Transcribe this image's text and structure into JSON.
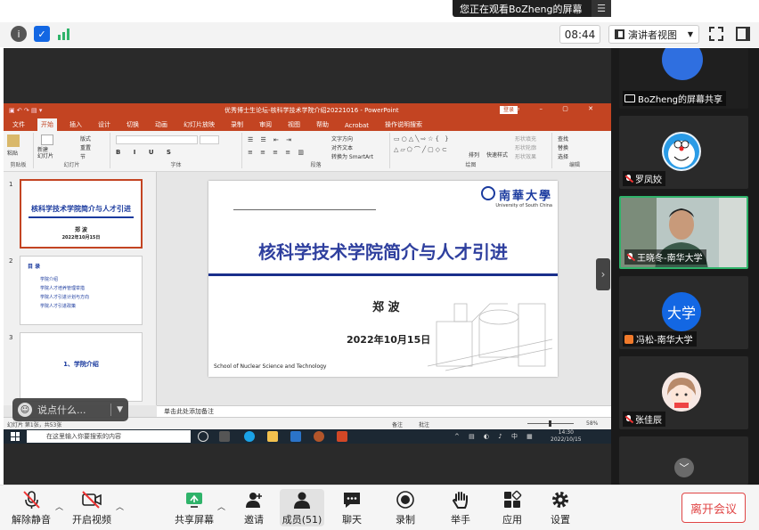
{
  "banner": {
    "text": "您正在观看BoZheng的屏幕"
  },
  "topbar": {
    "time": "08:44",
    "view_mode": "演讲者视图"
  },
  "ppt": {
    "window_title": "优秀博士生论坛-核科学技术学院介绍20221016 - PowerPoint",
    "login": "登录",
    "tabs": [
      "文件",
      "开始",
      "插入",
      "设计",
      "切换",
      "动画",
      "幻灯片放映",
      "录制",
      "审阅",
      "视图",
      "帮助",
      "Acrobat",
      "操作说明搜索"
    ],
    "ribbon": {
      "paste": "粘贴",
      "clipboard": "剪贴板",
      "new_slide": "新建\n幻灯片",
      "layout": "版式",
      "reset": "重置",
      "section": "节",
      "slides": "幻灯片",
      "font": "字体",
      "text_direction": "文字方向",
      "align_text": "对齐文本",
      "smartart": "转换为 SmartArt",
      "paragraph": "段落",
      "arrange": "排列",
      "quick_styles": "快速样式",
      "shape_fill": "形状填充",
      "shape_outline": "形状轮廓",
      "shape_effects": "形状效果",
      "drawing": "绘图",
      "find": "查找",
      "replace": "替换",
      "select": "选择",
      "editing": "编辑"
    },
    "thumbnails": [
      {
        "num": "1",
        "title": "核科学技术学院简介与人才引进",
        "name": "郑 波",
        "date": "2022年10月15日"
      },
      {
        "num": "2",
        "heading": "目 录",
        "items": [
          "学院介绍",
          "学院人才培养管理举措",
          "学院人才引进计划与方向",
          "学院人才引进政策"
        ]
      },
      {
        "num": "3",
        "title": "1、学院介绍"
      }
    ],
    "slide": {
      "logo_cn": "南華大學",
      "logo_en": "University of South China",
      "title": "核科学技术学院简介与人才引进",
      "name": "郑  波",
      "date": "2022年10月15日",
      "school": "School of Nuclear Science and Technology"
    },
    "notes_placeholder": "单击此处添加备注",
    "status": {
      "left": "幻灯片 第1张，共53张",
      "notes": "备注",
      "comments": "批注",
      "zoom": "58%"
    }
  },
  "chat": {
    "placeholder": "说点什么..."
  },
  "taskbar": {
    "search": "在这里输入你要搜索的内容",
    "time": "14:30",
    "date": "2022/10/15"
  },
  "participants": [
    {
      "name": "BoZheng的屏幕共享",
      "type": "share"
    },
    {
      "name": "罗凤姣",
      "type": "avatar-doraemon"
    },
    {
      "name": "王晓冬-南华大学",
      "type": "video"
    },
    {
      "name": "冯松-南华大学",
      "type": "avatar-text",
      "avatar_text": "大学"
    },
    {
      "name": "张佳辰",
      "type": "avatar-girl"
    }
  ],
  "bottombar": {
    "unmute": "解除静音",
    "start_video": "开启视频",
    "share_screen": "共享屏幕",
    "invite": "邀请",
    "members": "成员(51)",
    "chat": "聊天",
    "record": "录制",
    "raise_hand": "举手",
    "apps": "应用",
    "settings": "设置",
    "leave": "离开会议"
  },
  "colors": {
    "ppt_red": "#c34422",
    "title_blue": "#2e3f9e",
    "zoom_green": "#2fb36a",
    "leave_red": "#e04545"
  }
}
